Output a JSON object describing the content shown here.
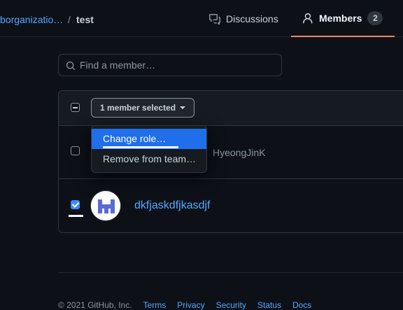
{
  "breadcrumb": {
    "org": "borganizatio…",
    "separator": "/",
    "team": "test"
  },
  "tabs": {
    "discussions": {
      "label": "Discussions",
      "icon": "comment-discussion-icon"
    },
    "members": {
      "label": "Members",
      "count": "2",
      "icon": "person-icon"
    }
  },
  "search": {
    "placeholder": "Find a member…",
    "value": ""
  },
  "bulk": {
    "selection_label": "1 member selected"
  },
  "menu": {
    "items": [
      "Change role…",
      "Remove from team…"
    ]
  },
  "members": [
    {
      "name": "HyeongJinK",
      "checked": false
    },
    {
      "name": "dkfjaskdfjkasdjf",
      "checked": true
    }
  ],
  "footer": {
    "copyright": "© 2021 GitHub, Inc.",
    "links": [
      "Terms",
      "Privacy",
      "Security",
      "Status",
      "Docs"
    ]
  },
  "colors": {
    "accent": "#58a6ff",
    "active_tab_border": "#f78166",
    "menu_highlight": "#1f6feb",
    "background": "#0d1117"
  }
}
